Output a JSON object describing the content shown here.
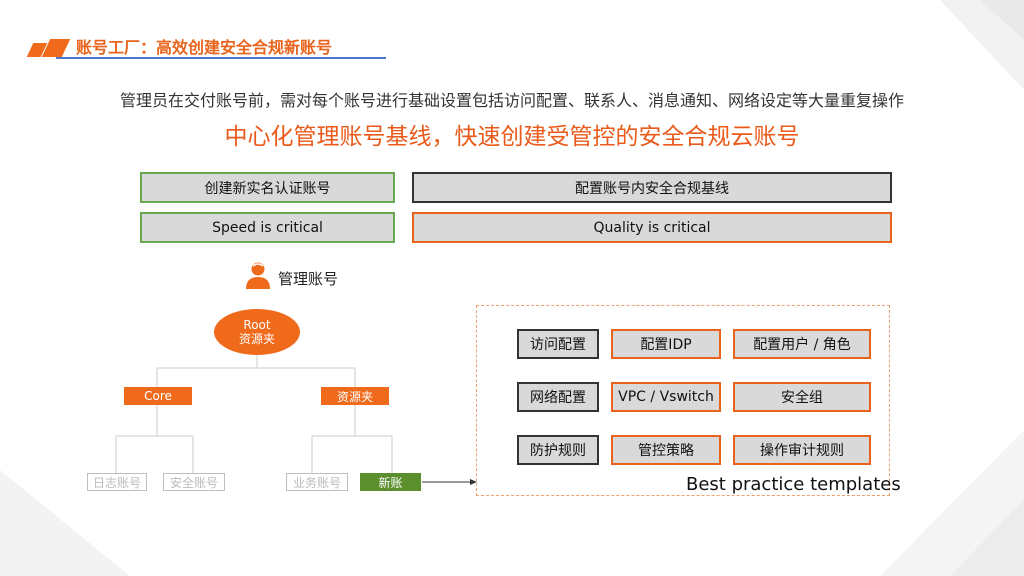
{
  "header": {
    "title": "账号工厂：高效创建安全合规新账号"
  },
  "subtitle": "管理员在交付账号前，需对每个账号进行基础设置包括访问配置、联系人、消息通知、网络设定等大量重复操作",
  "headline": "中心化管理账号基线，快速创建受管控的安全合规云账号",
  "left_top": "创建新实名认证账号",
  "left_bottom": "Speed is critical",
  "right_top": "配置账号内安全合规基线",
  "right_bottom": "Quality is critical",
  "admin": {
    "label": "管理账号"
  },
  "tree": {
    "root_line1": "Root",
    "root_line2": "资源夹",
    "core": "Core",
    "folder": "资源夹",
    "log_account": "日志账号",
    "security_account": "安全账号",
    "business_account": "业务账号",
    "new_account": "新账"
  },
  "best_practice": {
    "cells": [
      "访问配置",
      "配置IDP",
      "配置用户 / 角色",
      "网络配置",
      "VPC / Vswitch",
      "安全组",
      "防护规则",
      "管控策略",
      "操作审计规则"
    ],
    "caption": "Best practice templates"
  },
  "colors": {
    "accent_orange": "#f06a1c",
    "headline_orange": "#ea5a1a",
    "green": "#6aa84f",
    "new_account_green": "#5b8f2e",
    "header_line_blue": "#4a78c8"
  }
}
